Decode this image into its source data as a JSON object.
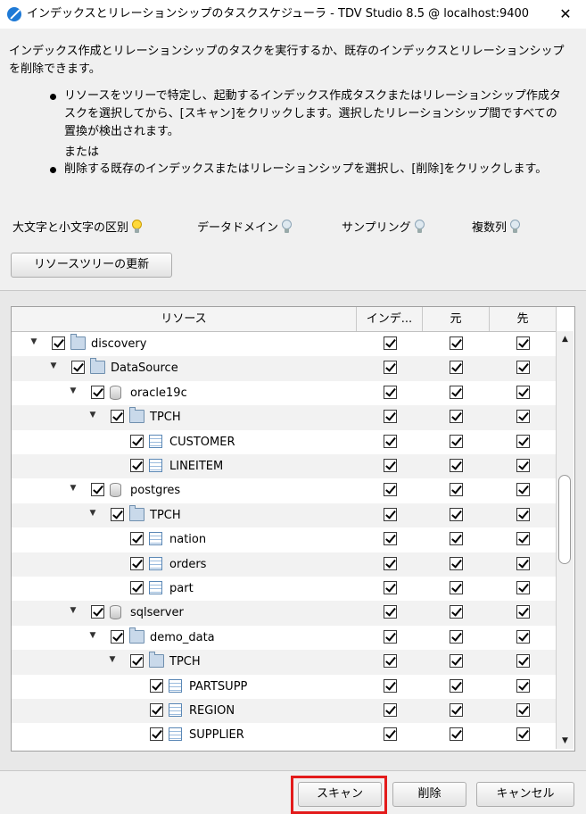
{
  "window": {
    "title": "インデックスとリレーションシップのタスクスケジューラ - TDV Studio 8.5 @ localhost:9400",
    "close_glyph": "✕"
  },
  "description": "インデックス作成とリレーションシップのタスクを実行するか、既存のインデックスとリレーションシップを削除できます。",
  "bullets": [
    "リソースをツリーで特定し、起動するインデックス作成タスクまたはリレーションシップ作成タスクを選択してから、[スキャン]をクリックします。選択したリレーションシップ間ですべての置換が検出されます。",
    "削除する既存のインデックスまたはリレーションシップを選択し、[削除]をクリックします。"
  ],
  "or_text": "または",
  "options": [
    {
      "label": "大文字と小文字の区別",
      "icon": "lightbulb-on-icon"
    },
    {
      "label": "データドメイン",
      "icon": "lightbulb-off-icon"
    },
    {
      "label": "サンプリング",
      "icon": "lightbulb-off-icon"
    },
    {
      "label": "複数列",
      "icon": "lightbulb-off-icon"
    }
  ],
  "refresh_button": "リソースツリーの更新",
  "table": {
    "columns": [
      "リソース",
      "インデ...",
      "元",
      "先"
    ],
    "rows": [
      {
        "name": "discovery",
        "type": "folder",
        "depth": 0,
        "expand": "▼"
      },
      {
        "name": "DataSource",
        "type": "folder",
        "depth": 1,
        "expand": "▼"
      },
      {
        "name": "oracle19c",
        "type": "database",
        "depth": 2,
        "expand": "▼"
      },
      {
        "name": "TPCH",
        "type": "folder",
        "depth": 3,
        "expand": "▼"
      },
      {
        "name": "CUSTOMER",
        "type": "table",
        "depth": 4,
        "expand": ""
      },
      {
        "name": "LINEITEM",
        "type": "table",
        "depth": 4,
        "expand": ""
      },
      {
        "name": "postgres",
        "type": "database",
        "depth": 2,
        "expand": "▼"
      },
      {
        "name": "TPCH",
        "type": "folder",
        "depth": 3,
        "expand": "▼"
      },
      {
        "name": "nation",
        "type": "table",
        "depth": 4,
        "expand": ""
      },
      {
        "name": "orders",
        "type": "table",
        "depth": 4,
        "expand": ""
      },
      {
        "name": "part",
        "type": "table",
        "depth": 4,
        "expand": ""
      },
      {
        "name": "sqlserver",
        "type": "database",
        "depth": 2,
        "expand": "▼"
      },
      {
        "name": "demo_data",
        "type": "folder",
        "depth": 3,
        "expand": "▼"
      },
      {
        "name": "TPCH",
        "type": "folder",
        "depth": 4,
        "expand": "▼"
      },
      {
        "name": "PARTSUPP",
        "type": "table",
        "depth": 5,
        "expand": ""
      },
      {
        "name": "REGION",
        "type": "table",
        "depth": 5,
        "expand": ""
      },
      {
        "name": "SUPPLIER",
        "type": "table",
        "depth": 5,
        "expand": ""
      }
    ]
  },
  "scrollbar": {
    "up": "▲",
    "down": "▼"
  },
  "buttons": {
    "scan": "スキャン",
    "delete": "削除",
    "cancel": "キャンセル"
  }
}
